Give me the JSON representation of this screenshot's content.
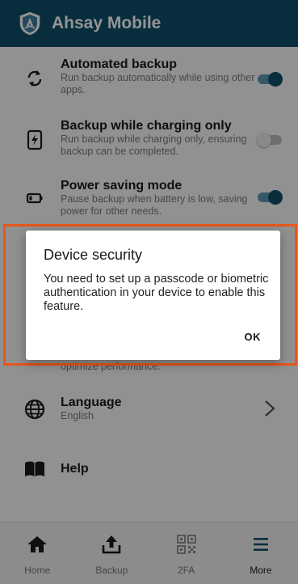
{
  "header": {
    "title": "Ahsay Mobile"
  },
  "settings": {
    "automated_backup": {
      "title": "Automated backup",
      "description": "Run backup automatically while using other apps.",
      "enabled": true,
      "icon": "sync-icon"
    },
    "backup_while_charging": {
      "title": "Backup while charging only",
      "description": "Run backup while charging only, ensuring backup can be completed.",
      "enabled": false,
      "icon": "charging-icon"
    },
    "power_saving": {
      "title": "Power saving mode",
      "description": "Pause backup when battery is low, saving power for other needs.",
      "enabled": true,
      "icon": "battery-icon"
    },
    "obscured_row_desc": "optimize performance.",
    "language": {
      "title": "Language",
      "value": "English",
      "icon": "globe-icon"
    },
    "help": {
      "title": "Help",
      "icon": "book-icon"
    }
  },
  "bottom_nav": {
    "items": [
      {
        "label": "Home",
        "icon": "home-icon"
      },
      {
        "label": "Backup",
        "icon": "upload-icon"
      },
      {
        "label": "2FA",
        "icon": "qr-code-icon"
      },
      {
        "label": "More",
        "icon": "menu-icon",
        "active": true
      }
    ]
  },
  "dialog": {
    "title": "Device security",
    "message": "You need to set up a passcode or biometric authentication in your device to enable this feature.",
    "ok_label": "OK"
  },
  "colors": {
    "primary": "#0f5069",
    "highlight_border": "#e8561d"
  }
}
